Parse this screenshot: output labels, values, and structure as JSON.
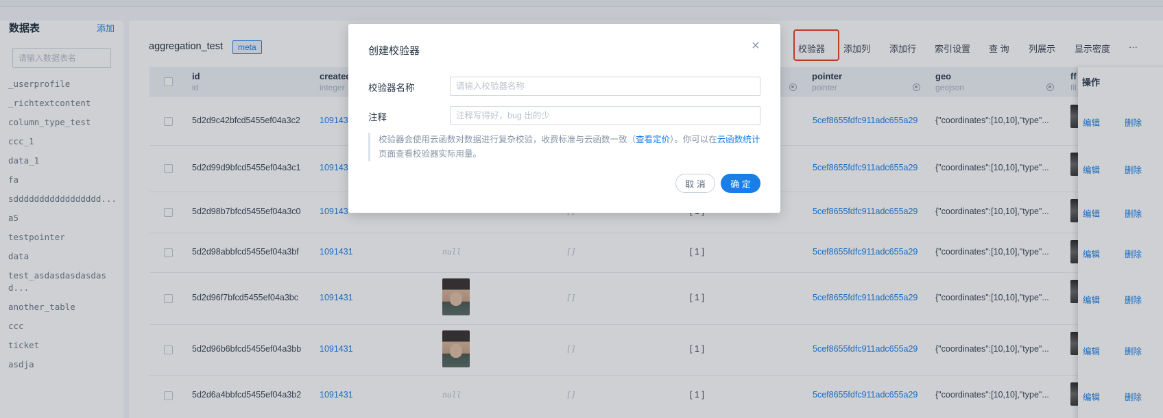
{
  "sidebar": {
    "title": "数据表",
    "add_label": "添加",
    "search_placeholder": "请输入数据表名",
    "tables": [
      "_userprofile",
      "_richtextcontent",
      "column_type_test",
      "ccc_1",
      "data_1",
      "fa",
      "sddddddddddddddddd...",
      "a5",
      "testpointer",
      "data",
      "test_asdasdasdasdasd...",
      "another_table",
      "ccc",
      "ticket",
      "asdja"
    ]
  },
  "collection": {
    "name": "aggregation_test",
    "badge": "meta"
  },
  "toolbar": {
    "validator": "校验器",
    "add_column": "添加列",
    "add_row": "添加行",
    "index_settings": "索引设置",
    "query": "查 询",
    "columns_display": "列展示",
    "density": "显示密度",
    "more": "···"
  },
  "table": {
    "columns": [
      {
        "name": "id",
        "type": "id"
      },
      {
        "name": "created",
        "type": "integer"
      },
      {
        "name": "pointer",
        "type": "pointer"
      },
      {
        "name": "geo",
        "type": "geojson"
      },
      {
        "name": "ff",
        "type": "fil"
      }
    ],
    "ops_header": "操作",
    "edit_label": "编辑",
    "delete_label": "删除",
    "rows": [
      {
        "id": "5d2d9c42bfcd5455ef04a3c2",
        "created": "109143",
        "image": "",
        "array": "",
        "num": "",
        "pointer": "5cef8655fdfc911adc655a29",
        "geo": "{\"coordinates\":[10,10],\"type\"..."
      },
      {
        "id": "5d2d99d9bfcd5455ef04a3c1",
        "created": "109143",
        "image": "",
        "array": "",
        "num": "",
        "pointer": "5cef8655fdfc911adc655a29",
        "geo": "{\"coordinates\":[10,10],\"type\"..."
      },
      {
        "id": "5d2d98b7bfcd5455ef04a3c0",
        "created": "109143",
        "image": "",
        "array": "[]",
        "num": "[ 1 ]",
        "pointer": "5cef8655fdfc911adc655a29",
        "geo": "{\"coordinates\":[10,10],\"type\"..."
      },
      {
        "id": "5d2d98abbfcd5455ef04a3bf",
        "created": "1091431",
        "image": "null",
        "array": "[]",
        "num": "[ 1 ]",
        "pointer": "5cef8655fdfc911adc655a29",
        "geo": "{\"coordinates\":[10,10],\"type\"..."
      },
      {
        "id": "5d2d96f7bfcd5455ef04a3bc",
        "created": "1091431",
        "image": "avatar",
        "array": "[]",
        "num": "[ 1 ]",
        "pointer": "5cef8655fdfc911adc655a29",
        "geo": "{\"coordinates\":[10,10],\"type\"..."
      },
      {
        "id": "5d2d96b6bfcd5455ef04a3bb",
        "created": "1091431",
        "image": "avatar",
        "array": "[]",
        "num": "[ 1 ]",
        "pointer": "5cef8655fdfc911adc655a29",
        "geo": "{\"coordinates\":[10,10],\"type\"..."
      },
      {
        "id": "5d2d6a4bbfcd5455ef04a3b2",
        "created": "1091431",
        "image": "null",
        "array": "[]",
        "num": "[ 1 ]",
        "pointer": "5cef8655fdfc911adc655a29",
        "geo": "{\"coordinates\":[10,10],\"type\"..."
      }
    ]
  },
  "modal": {
    "title": "创建校验器",
    "close": "×",
    "name_label": "校验器名称",
    "name_placeholder": "请输入校验器名称",
    "comment_label": "注释",
    "comment_placeholder": "注释写得好，bug 出的少",
    "note_part1": "校验器会使用云函数对数据进行复杂校验，收费标准与云函数一致（",
    "note_link1": "查看定价",
    "note_part2": "）。你可以在",
    "note_link2": "云函数统计",
    "note_part3": "页面查看校验器实际用量。",
    "cancel": "取 消",
    "confirm": "确 定"
  }
}
